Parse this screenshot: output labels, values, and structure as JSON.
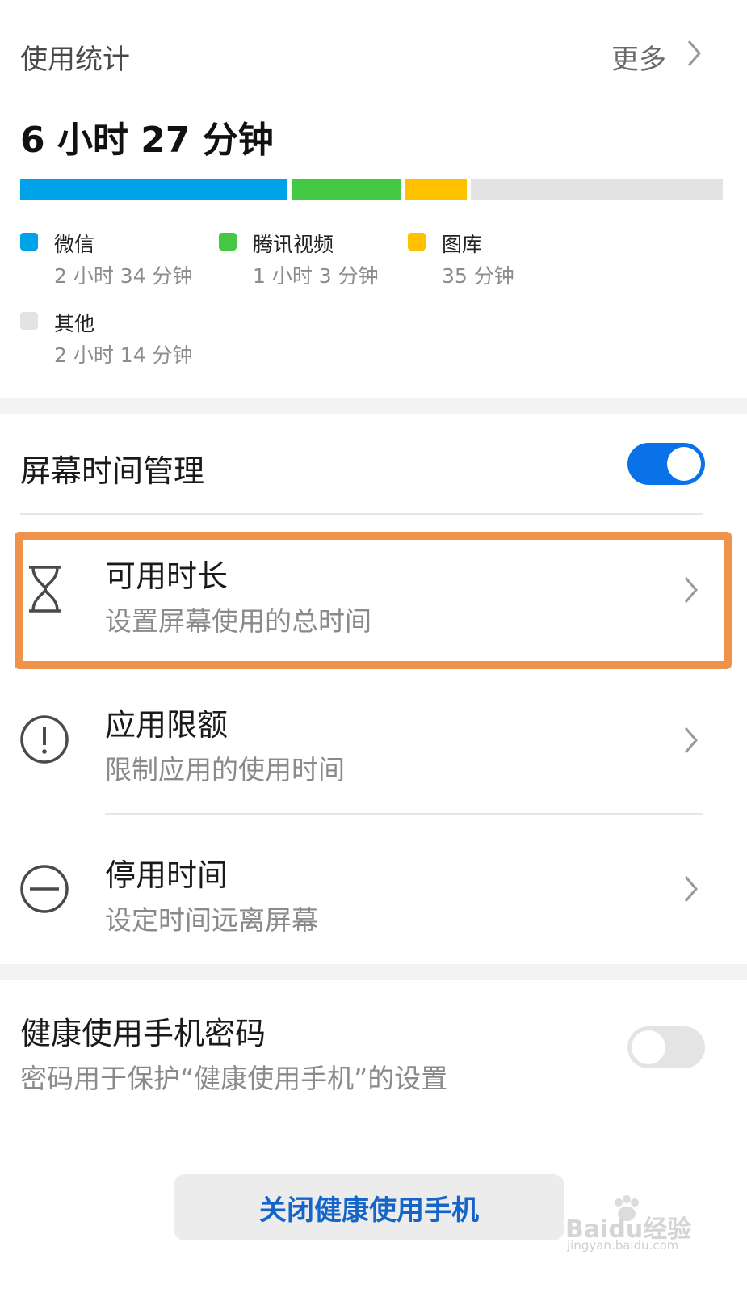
{
  "usage": {
    "title": "使用统计",
    "more_label": "更多",
    "total": "6 小时 27 分钟",
    "apps": [
      {
        "name": "微信",
        "time": "2 小时 34 分钟",
        "color": "#00a3e8",
        "minutes": 154
      },
      {
        "name": "腾讯视频",
        "time": "1 小时 3 分钟",
        "color": "#45c944",
        "minutes": 63
      },
      {
        "name": "图库",
        "time": "35 分钟",
        "color": "#ffc000",
        "minutes": 35
      },
      {
        "name": "其他",
        "time": "2 小时 14 分钟",
        "color": "#e3e3e3",
        "minutes": 134
      }
    ]
  },
  "screen_time": {
    "title": "屏幕时间管理",
    "enabled": true,
    "toggle_color": "#0a72e9",
    "items": [
      {
        "title": "可用时长",
        "subtitle": "设置屏幕使用的总时间",
        "icon": "hourglass-icon"
      },
      {
        "title": "应用限额",
        "subtitle": "限制应用的使用时间",
        "icon": "exclamation-circle-icon"
      },
      {
        "title": "停用时间",
        "subtitle": "设定时间远离屏幕",
        "icon": "minus-circle-icon"
      }
    ]
  },
  "password": {
    "title": "健康使用手机密码",
    "subtitle": "密码用于保护“健康使用手机”的设置",
    "enabled": false
  },
  "close_button_label": "关闭健康使用手机",
  "highlight_color": "#f0924a",
  "watermark": {
    "brand": "Baidu经验",
    "url": "jingyan.baidu.com"
  }
}
